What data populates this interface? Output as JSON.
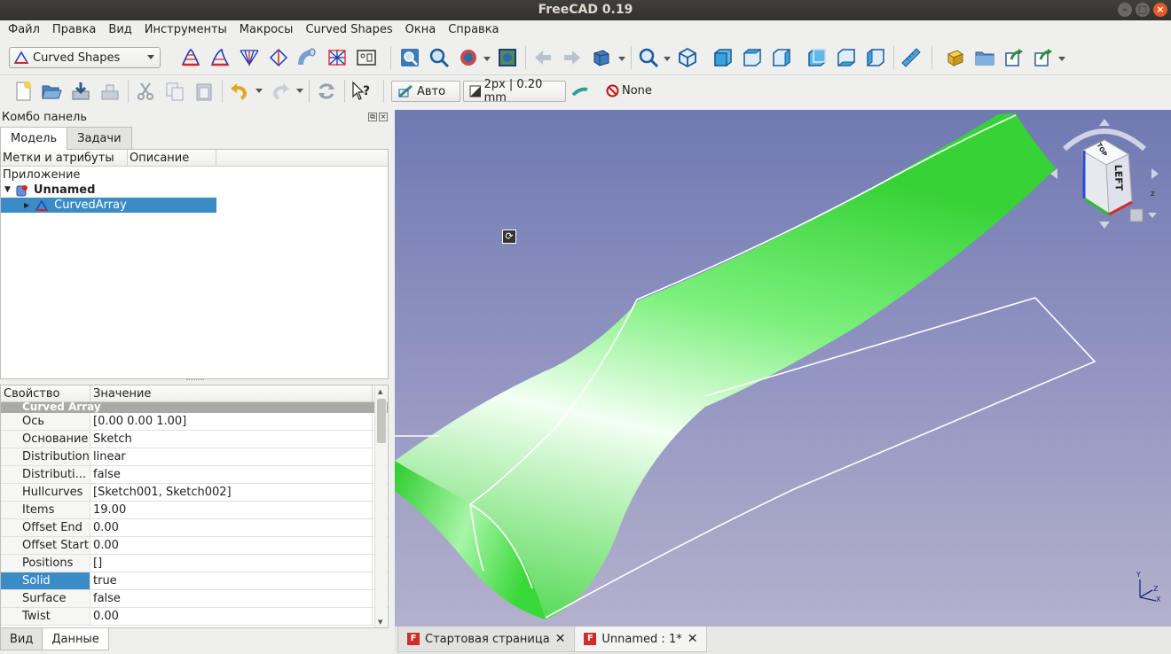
{
  "window": {
    "title": "FreeCAD 0.19"
  },
  "menubar": [
    "Файл",
    "Правка",
    "Вид",
    "Инструменты",
    "Макросы",
    "Curved Shapes",
    "Окна",
    "Справка"
  ],
  "toolbar": {
    "workbench": "Curved Shapes",
    "draw_style": "Авто",
    "line_width": "2px | 0.20 mm",
    "snap": "None"
  },
  "combo": {
    "title": "Комбо панель",
    "tabs": [
      "Модель",
      "Задачи"
    ],
    "tree_headers": [
      "Метки и атрибуты",
      "Описание"
    ],
    "tree_root": "Приложение",
    "document": "Unnamed",
    "object": "CurvedArray"
  },
  "properties": {
    "headers": [
      "Свойство",
      "Значение"
    ],
    "group": "Curved Array",
    "rows": [
      {
        "name": "Ось",
        "value": "[0.00 0.00 1.00]"
      },
      {
        "name": "Основание",
        "value": "Sketch"
      },
      {
        "name": "Distribution",
        "value": "linear"
      },
      {
        "name": "Distributi...",
        "value": "false"
      },
      {
        "name": "Hullcurves",
        "value": "[Sketch001, Sketch002]"
      },
      {
        "name": "Items",
        "value": "19.00"
      },
      {
        "name": "Offset End",
        "value": "0.00"
      },
      {
        "name": "Offset Start",
        "value": "0.00"
      },
      {
        "name": "Positions",
        "value": "[]"
      },
      {
        "name": "Solid",
        "value": "true"
      },
      {
        "name": "Surface",
        "value": "false"
      },
      {
        "name": "Twist",
        "value": "0.00"
      }
    ],
    "bottom_tabs": [
      "Вид",
      "Данные"
    ]
  },
  "view3d": {
    "navcube_face": "LEFT",
    "navcube_top": "TOP",
    "axis_z": "z",
    "axis_y": "Y",
    "axis_x": "X",
    "axis_z2": "Z"
  },
  "doc_tabs": [
    "Стартовая страница",
    "Unnamed : 1*"
  ],
  "colors": {
    "shape": "#55e855",
    "selection": "#3b8bc6",
    "bg_top": "#6f79b2",
    "bg_bottom": "#b3b1cc"
  }
}
